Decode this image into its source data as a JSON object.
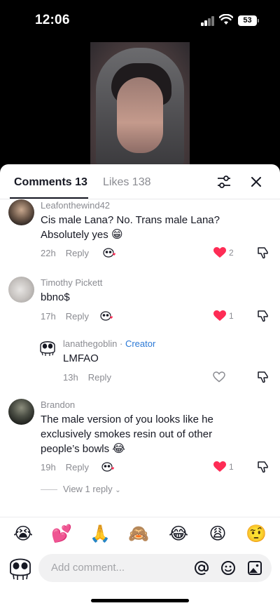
{
  "status": {
    "time": "12:06",
    "battery": "53"
  },
  "tabs": {
    "comments": "Comments 13",
    "likes": "Likes 138"
  },
  "comments": [
    {
      "user": "Leafonthewind42",
      "text": "Cis male Lana? No. Trans male Lana? Absolutely yes",
      "emoji": "😁",
      "time": "22h",
      "reply": "Reply",
      "likes": "2"
    },
    {
      "user": "Timothy Pickett",
      "text": "bbno$",
      "time": "17h",
      "reply": "Reply",
      "likes": "1"
    },
    {
      "user": "lanathegoblin",
      "separator": "·",
      "creator_label": "Creator",
      "text": "LMFAO",
      "time": "13h",
      "reply": "Reply"
    },
    {
      "user": "Brandon",
      "text": "The male version of you looks like he exclusively smokes resin out of other people’s bowls",
      "emoji": "😂",
      "time": "19h",
      "reply": "Reply",
      "likes": "1"
    }
  ],
  "view_replies": "View 1 reply",
  "emoji_bar": [
    "😭",
    "💕",
    "🙏",
    "🙈",
    "😂",
    "😩",
    "🤨"
  ],
  "input": {
    "placeholder": "Add comment..."
  },
  "colors": {
    "heart": "#fe2c55",
    "creator": "#2b79d6"
  }
}
